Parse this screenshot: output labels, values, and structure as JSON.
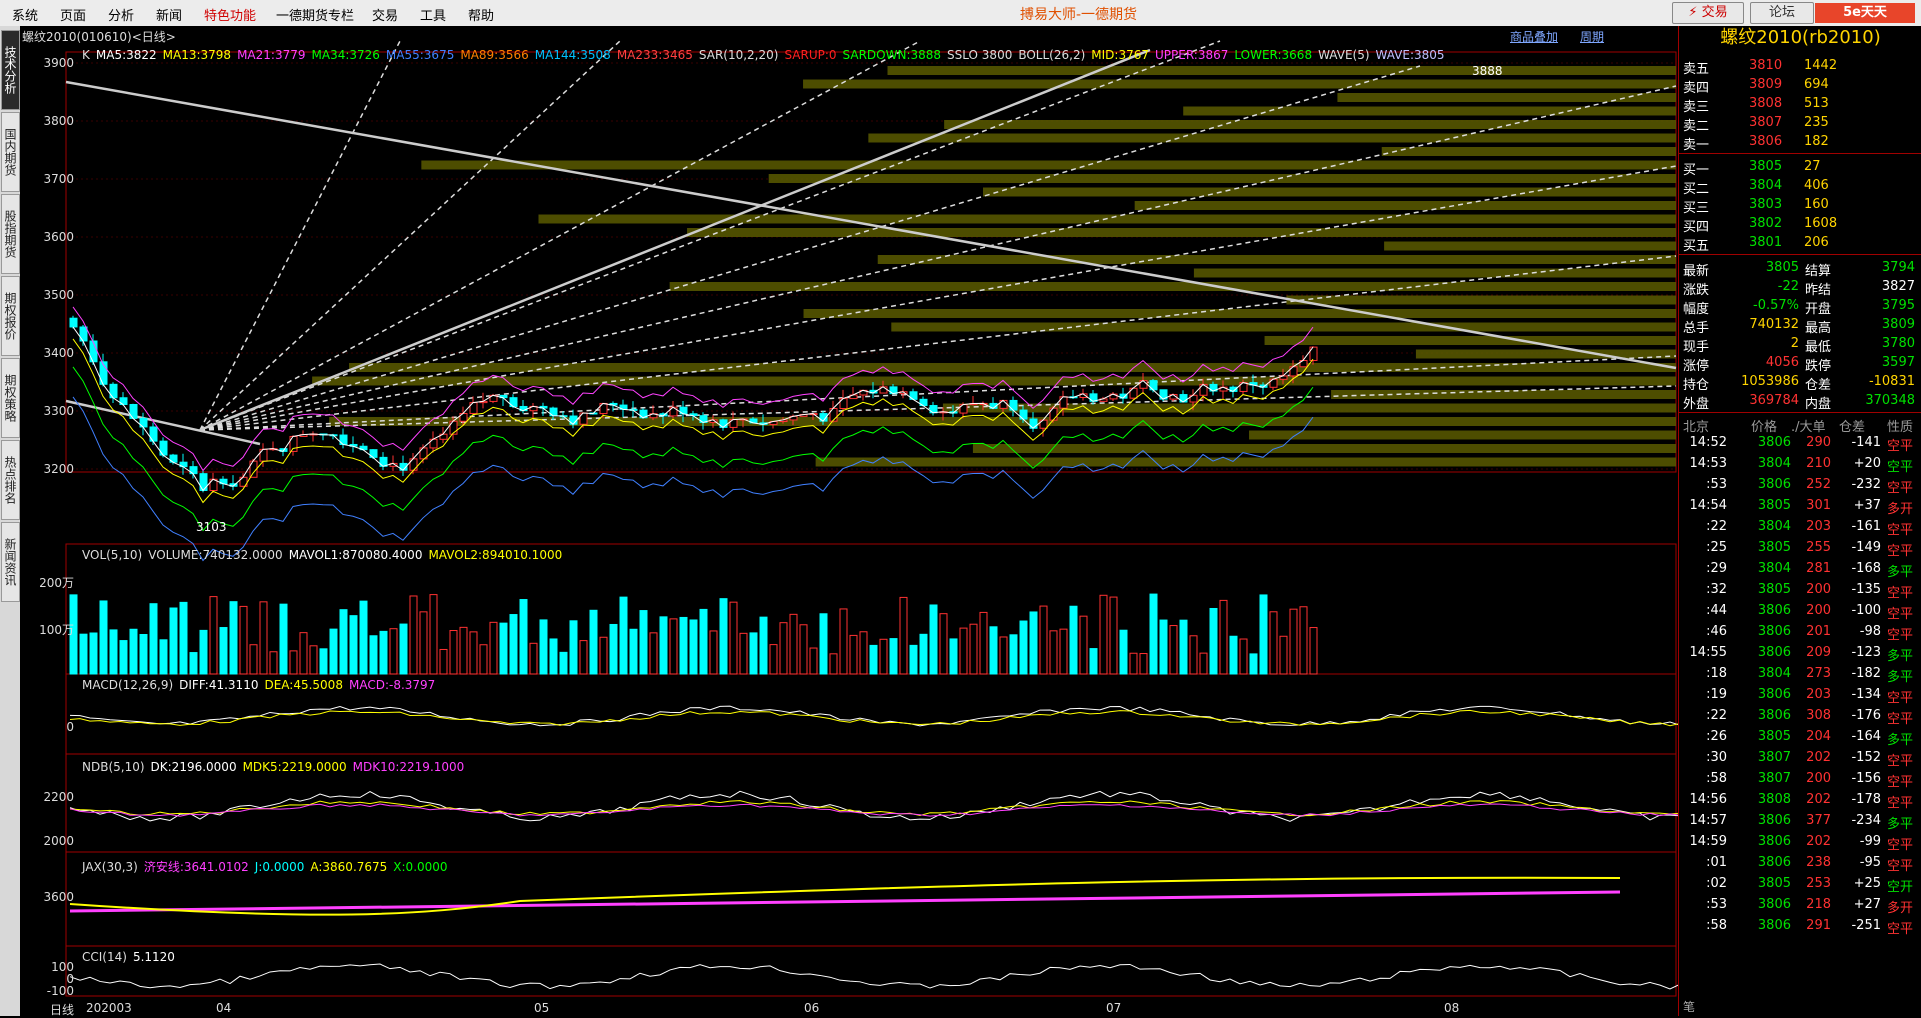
{
  "menu": {
    "items": [
      "系统",
      "页面",
      "分析",
      "新闻",
      "特色功能",
      "一德期货专栏",
      "交易",
      "工具",
      "帮助"
    ],
    "special_index": 4,
    "app_title": "搏易大师-一德期货",
    "trade_btn": "⚡ 交易",
    "forum_btn": "论坛",
    "logo": "5e天天",
    "win_buttons": [
      "_",
      "□",
      "×"
    ]
  },
  "left_tabs": [
    "技术分析",
    "国内期货",
    "股指期货",
    "期权报价",
    "期权策略",
    "热点排名",
    "新闻资讯"
  ],
  "chart": {
    "subtitle": "螺纹2010(010610)<日线>",
    "tools": [
      "商品叠加",
      "周期"
    ],
    "main_legend": [
      {
        "t": "K",
        "c": "#dddddd"
      },
      {
        "t": "MA5:3822",
        "c": "#ffffff"
      },
      {
        "t": "MA13:3798",
        "c": "#ffff00"
      },
      {
        "t": "MA21:3779",
        "c": "#ff40ff"
      },
      {
        "t": "MA34:3726",
        "c": "#00ff00"
      },
      {
        "t": "MA55:3675",
        "c": "#4080ff"
      },
      {
        "t": "MA89:3566",
        "c": "#ff8000"
      },
      {
        "t": "MA144:3508",
        "c": "#00c0ff"
      },
      {
        "t": "MA233:3465",
        "c": "#ff4040"
      },
      {
        "t": "SAR(10,2,20)",
        "c": "#dddddd"
      },
      {
        "t": "SARUP:0",
        "c": "#ff2020"
      },
      {
        "t": "SARDOWN:3888",
        "c": "#00ff00"
      },
      {
        "t": "SSLO 3800",
        "c": "#dddddd"
      },
      {
        "t": "BOLL(26,2)",
        "c": "#dddddd"
      },
      {
        "t": "MID:3767",
        "c": "#ffff00"
      },
      {
        "t": "UPPER:3867",
        "c": "#ff40ff"
      },
      {
        "t": "LOWER:3668",
        "c": "#00ff00"
      },
      {
        "t": "WAVE(5)",
        "c": "#dddddd"
      },
      {
        "t": "WAVE:3805",
        "c": "#c0c0ff"
      }
    ],
    "y_ticks": [
      "3900",
      "3800",
      "3700",
      "3600",
      "3500",
      "3400",
      "3300",
      "3200"
    ],
    "high_label": "3888",
    "low_label": "3103",
    "vol_legend": [
      {
        "t": "VOL(5,10)",
        "c": "#dddddd"
      },
      {
        "t": "VOLUME:740132.0000",
        "c": "#dddddd"
      },
      {
        "t": "MAVOL1:870080.4000",
        "c": "#ffffff"
      },
      {
        "t": "MAVOL2:894010.1000",
        "c": "#ffff00"
      }
    ],
    "vol_ticks": [
      "200万",
      "100万"
    ],
    "macd_legend": [
      {
        "t": "MACD(12,26,9)",
        "c": "#dddddd"
      },
      {
        "t": "DIFF:41.3110",
        "c": "#ffffff"
      },
      {
        "t": "DEA:45.5008",
        "c": "#ffff00"
      },
      {
        "t": "MACD:-8.3797",
        "c": "#ff40ff"
      }
    ],
    "macd_ticks": [
      "0"
    ],
    "ndb_legend": [
      {
        "t": "NDB(5,10)",
        "c": "#dddddd"
      },
      {
        "t": "DK:2196.0000",
        "c": "#ffffff"
      },
      {
        "t": "MDK5:2219.0000",
        "c": "#ffff00"
      },
      {
        "t": "MDK10:2219.1000",
        "c": "#ff40ff"
      }
    ],
    "ndb_ticks": [
      "2200",
      "2000"
    ],
    "jax_legend": [
      {
        "t": "JAX(30,3)",
        "c": "#dddddd"
      },
      {
        "t": "济安线:3641.0102",
        "c": "#ff40ff"
      },
      {
        "t": "J:0.0000",
        "c": "#00ffff"
      },
      {
        "t": "A:3860.7675",
        "c": "#ffff00"
      },
      {
        "t": "X:0.0000",
        "c": "#00ff00"
      }
    ],
    "jax_ticks": [
      "3600"
    ],
    "cci_legend": [
      {
        "t": "CCI(14)",
        "c": "#dddddd"
      },
      {
        "t": "5.1120",
        "c": "#ffffff"
      }
    ],
    "cci_ticks": [
      "100",
      "0",
      "-100"
    ],
    "x_labels": [
      "日线",
      "202003",
      "04",
      "05",
      "06",
      "07",
      "08"
    ]
  },
  "quote": {
    "title": "螺纹2010(rb2010)",
    "asks": [
      {
        "label": "卖五",
        "price": "3810",
        "vol": "1442"
      },
      {
        "label": "卖四",
        "price": "3809",
        "vol": "694"
      },
      {
        "label": "卖三",
        "price": "3808",
        "vol": "513"
      },
      {
        "label": "卖二",
        "price": "3807",
        "vol": "235"
      },
      {
        "label": "卖一",
        "price": "3806",
        "vol": "182"
      }
    ],
    "bids": [
      {
        "label": "买一",
        "price": "3805",
        "vol": "27"
      },
      {
        "label": "买二",
        "price": "3804",
        "vol": "406"
      },
      {
        "label": "买三",
        "price": "3803",
        "vol": "160"
      },
      {
        "label": "买四",
        "price": "3802",
        "vol": "1608"
      },
      {
        "label": "买五",
        "price": "3801",
        "vol": "206"
      }
    ],
    "stats": [
      {
        "l1": "最新",
        "v1": "3805",
        "c1": "green",
        "l2": "结算",
        "v2": "3794",
        "c2": "green"
      },
      {
        "l1": "涨跌",
        "v1": "-22",
        "c1": "green",
        "l2": "昨结",
        "v2": "3827",
        "c2": "white"
      },
      {
        "l1": "幅度",
        "v1": "-0.57%",
        "c1": "green",
        "l2": "开盘",
        "v2": "3795",
        "c2": "green"
      },
      {
        "l1": "总手",
        "v1": "740132",
        "c1": "yellow",
        "l2": "最高",
        "v2": "3809",
        "c2": "green"
      },
      {
        "l1": "现手",
        "v1": "2",
        "c1": "yellow",
        "l2": "最低",
        "v2": "3780",
        "c2": "green"
      },
      {
        "l1": "涨停",
        "v1": "4056",
        "c1": "red",
        "l2": "跌停",
        "v2": "3597",
        "c2": "green"
      },
      {
        "l1": "持仓",
        "v1": "1053986",
        "c1": "yellow",
        "l2": "仓差",
        "v2": "-10831",
        "c2": "yellow"
      },
      {
        "l1": "外盘",
        "v1": "369784",
        "c1": "red",
        "l2": "内盘",
        "v2": "370348",
        "c2": "green"
      }
    ],
    "tick_header": [
      "北京",
      "价格",
      "./大单",
      "仓差",
      "性质"
    ],
    "ticks": [
      {
        "t": "14:52",
        "p": "3806",
        "v": "290",
        "d": "-141",
        "n": "空平",
        "nc": "red"
      },
      {
        "t": "14:53",
        "p": "3804",
        "v": "210",
        "d": "+20",
        "n": "空平",
        "nc": "green"
      },
      {
        "t": ":53",
        "p": "3806",
        "v": "252",
        "d": "-232",
        "n": "空平",
        "nc": "red"
      },
      {
        "t": "14:54",
        "p": "3805",
        "v": "301",
        "d": "+37",
        "n": "多开",
        "nc": "red"
      },
      {
        "t": ":22",
        "p": "3804",
        "v": "203",
        "d": "-161",
        "n": "空平",
        "nc": "red"
      },
      {
        "t": ":25",
        "p": "3805",
        "v": "255",
        "d": "-149",
        "n": "空平",
        "nc": "red"
      },
      {
        "t": ":29",
        "p": "3804",
        "v": "281",
        "d": "-168",
        "n": "多平",
        "nc": "green"
      },
      {
        "t": ":32",
        "p": "3805",
        "v": "200",
        "d": "-135",
        "n": "空平",
        "nc": "red"
      },
      {
        "t": ":44",
        "p": "3806",
        "v": "200",
        "d": "-100",
        "n": "空平",
        "nc": "red"
      },
      {
        "t": ":46",
        "p": "3806",
        "v": "201",
        "d": "-98",
        "n": "空平",
        "nc": "red"
      },
      {
        "t": "14:55",
        "p": "3806",
        "v": "209",
        "d": "-123",
        "n": "多平",
        "nc": "green"
      },
      {
        "t": ":18",
        "p": "3804",
        "v": "273",
        "d": "-182",
        "n": "多平",
        "nc": "green"
      },
      {
        "t": ":19",
        "p": "3806",
        "v": "203",
        "d": "-134",
        "n": "空平",
        "nc": "red"
      },
      {
        "t": ":22",
        "p": "3806",
        "v": "308",
        "d": "-176",
        "n": "空平",
        "nc": "red"
      },
      {
        "t": ":26",
        "p": "3805",
        "v": "204",
        "d": "-164",
        "n": "多平",
        "nc": "green"
      },
      {
        "t": ":30",
        "p": "3807",
        "v": "202",
        "d": "-152",
        "n": "空平",
        "nc": "red"
      },
      {
        "t": ":58",
        "p": "3807",
        "v": "200",
        "d": "-156",
        "n": "空平",
        "nc": "red"
      },
      {
        "t": "14:56",
        "p": "3808",
        "v": "202",
        "d": "-178",
        "n": "空平",
        "nc": "red"
      },
      {
        "t": "14:57",
        "p": "3806",
        "v": "377",
        "d": "-234",
        "n": "多平",
        "nc": "green"
      },
      {
        "t": "14:59",
        "p": "3806",
        "v": "202",
        "d": "-99",
        "n": "空平",
        "nc": "red"
      },
      {
        "t": ":01",
        "p": "3806",
        "v": "238",
        "d": "-95",
        "n": "空平",
        "nc": "red"
      },
      {
        "t": ":02",
        "p": "3805",
        "v": "253",
        "d": "+25",
        "n": "空开",
        "nc": "green"
      },
      {
        "t": ":53",
        "p": "3806",
        "v": "218",
        "d": "+27",
        "n": "多开",
        "nc": "red"
      },
      {
        "t": ":58",
        "p": "3806",
        "v": "291",
        "d": "-251",
        "n": "空平",
        "nc": "red"
      }
    ],
    "bottom_label": "笔"
  }
}
